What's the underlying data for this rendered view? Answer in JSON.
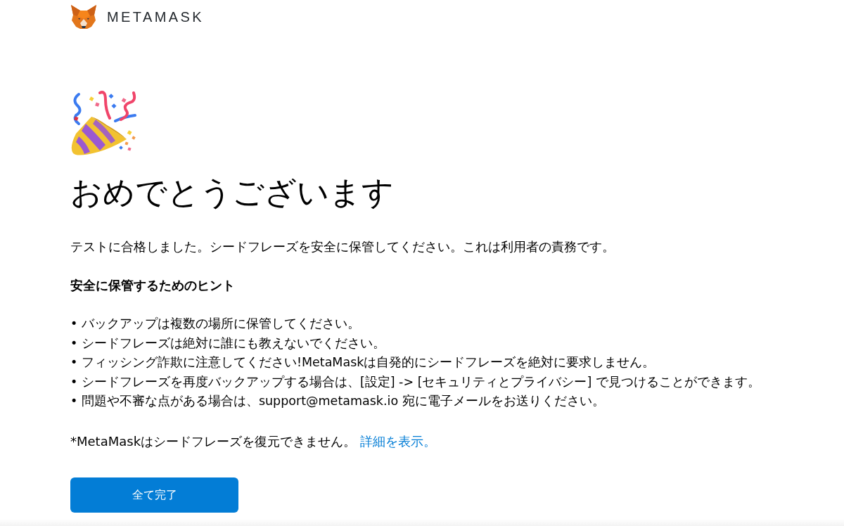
{
  "header": {
    "logo_text": "METAMASK"
  },
  "title": "おめでとうございます",
  "intro": "テストに合格しました。シードフレーズを安全に保管してください。これは利用者の責務です。",
  "tips": {
    "heading": "安全に保管するためのヒント",
    "items": [
      "• バックアップは複数の場所に保管してください。",
      "• シードフレーズは絶対に誰にも教えないでください。",
      "• フィッシング詐欺に注意してください!MetaMaskは自発的にシードフレーズを絶対に要求しません。",
      "• シードフレーズを再度バックアップする場合は、[設定] -> [セキュリティとプライバシー] で見つけることができます。",
      "• 問題や不審な点がある場合は、support@metamask.io 宛に電子メールをお送りください。"
    ]
  },
  "note": {
    "text": "*MetaMaskはシードフレーズを復元できません。",
    "link": "詳細を表示。"
  },
  "button": {
    "label": "全て完了"
  }
}
